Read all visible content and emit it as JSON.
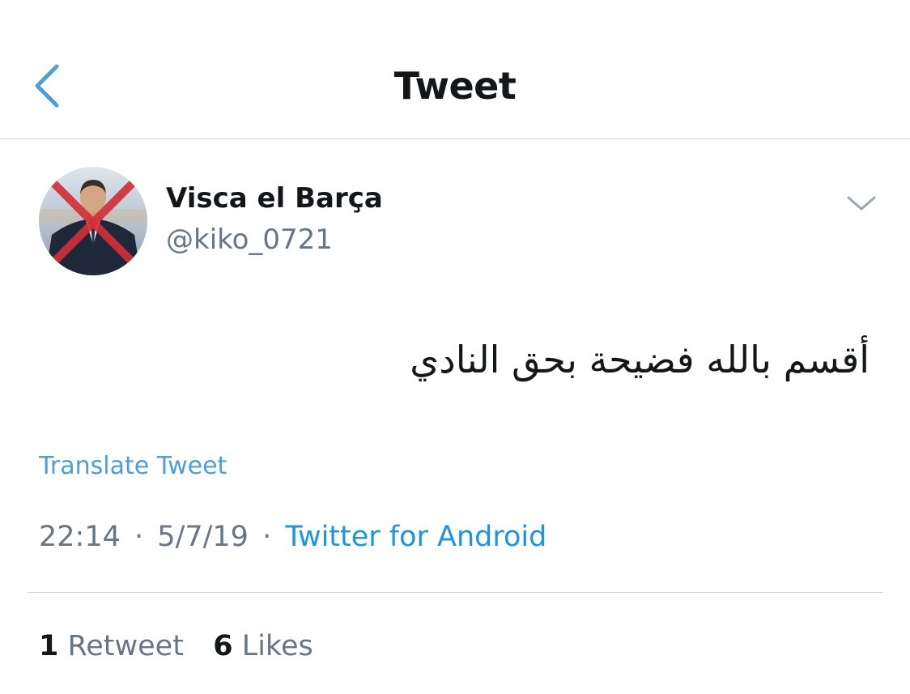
{
  "nav": {
    "title": "Tweet",
    "back_icon": "chevron-left-icon"
  },
  "tweet": {
    "author_name": "Visca el Barça",
    "author_handle": "@kiko_0721",
    "avatar_icon": "avatar-crossed-out",
    "menu_icon": "chevron-down-icon",
    "text": "أقسم بالله فضيحة بحق النادي",
    "translate_label": "Translate Tweet",
    "time": "22:14",
    "date": "5/7/19",
    "separator": "·",
    "source": "Twitter for Android"
  },
  "stats": {
    "retweets_count": "1",
    "retweets_label": "Retweet",
    "likes_count": "6",
    "likes_label": "Likes"
  },
  "colors": {
    "accent": "#1b95e0",
    "link": "#4a9fe0",
    "secondary_text": "#657786",
    "primary_text": "#14171a",
    "divider": "#cfd3d6"
  }
}
